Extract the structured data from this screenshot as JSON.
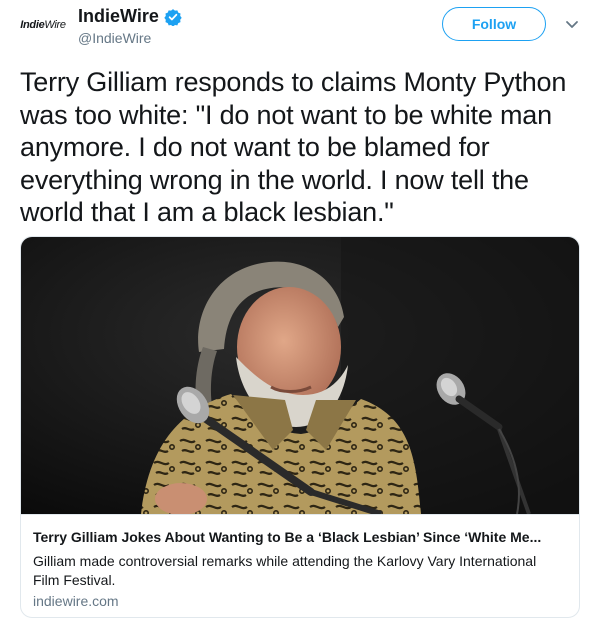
{
  "account": {
    "avatar_text_1": "Indie",
    "avatar_text_2": "Wire",
    "display_name": "IndieWire",
    "handle": "@IndieWire",
    "verified_icon": "verified-badge-icon"
  },
  "actions": {
    "follow_label": "Follow",
    "menu_icon": "chevron-down-icon"
  },
  "tweet": {
    "text": "Terry Gilliam responds to claims Monty Python was too white: \"I do not want to be white man anymore. I do not want to be blamed for everything wrong in the world. I now tell the world that I am a black lesbian.\""
  },
  "card": {
    "title": "Terry Gilliam Jokes About Wanting to Be a ‘Black Lesbian’ Since ‘White Me...",
    "description": "Gilliam made controversial remarks while attending the Karlovy Vary International Film Festival.",
    "domain": "indiewire.com"
  },
  "colors": {
    "accent": "#1da1f2",
    "text": "#14171a",
    "secondary": "#657786",
    "border": "#e1e8ed"
  }
}
